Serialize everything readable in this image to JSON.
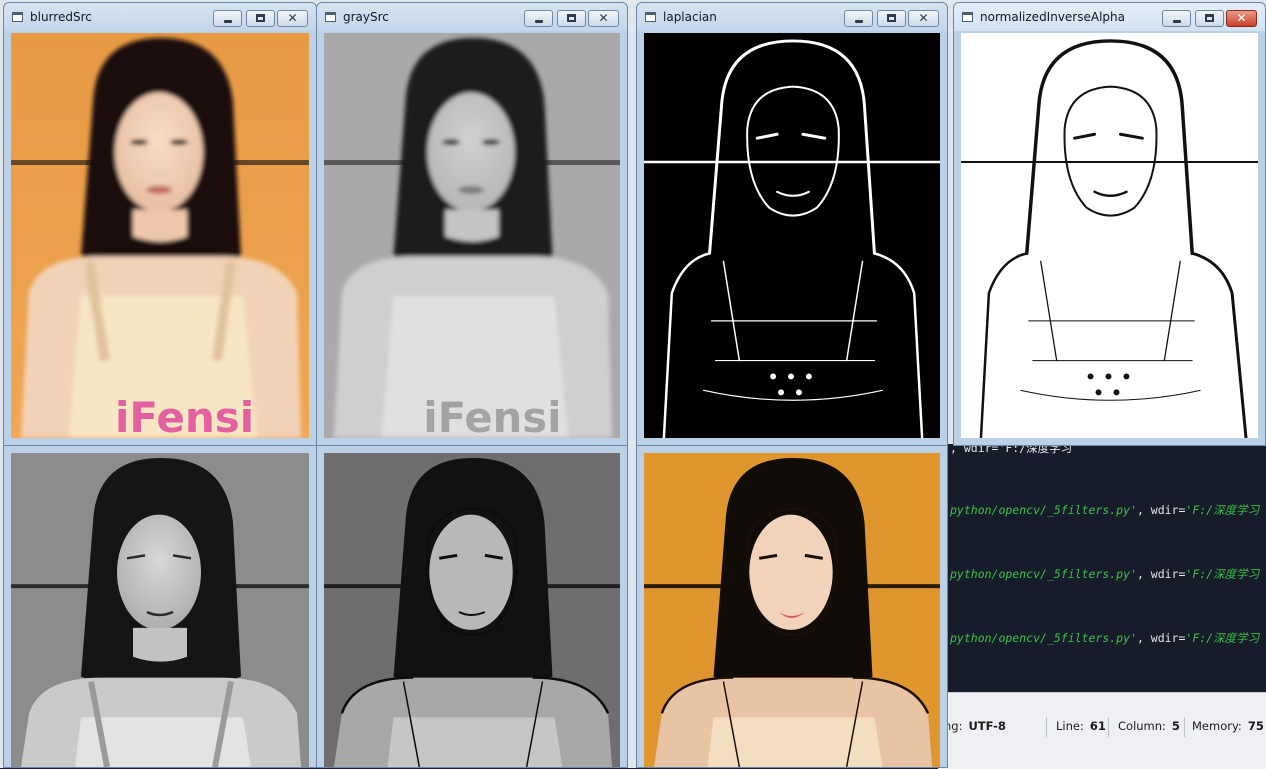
{
  "windows": [
    {
      "id": "blurredSrc",
      "title": "blurredSrc",
      "active": false,
      "controls": {
        "minimize": "minimize",
        "maximize": "maximize",
        "close": "close"
      }
    },
    {
      "id": "graySrc",
      "title": "graySrc",
      "active": false,
      "controls": {
        "minimize": "minimize",
        "maximize": "maximize",
        "close": "close"
      }
    },
    {
      "id": "laplacian",
      "title": "laplacian",
      "active": false,
      "controls": {
        "minimize": "minimize",
        "maximize": "maximize",
        "close": "close"
      }
    },
    {
      "id": "normalizedInverseAlpha",
      "title": "normalizedInverseAlpha",
      "active": true,
      "controls": {
        "minimize": "minimize",
        "maximize": "maximize",
        "close": "close"
      }
    }
  ],
  "image_overlay_text": "iFensi",
  "console": {
    "lines": [
      {
        "prefix": "",
        "path": "python/opencv/_5filters.py'",
        "sep": ", wdir=",
        "wdir": "'F:/深度学习"
      },
      {
        "prefix": "",
        "path": "python/opencv/_5filters.py'",
        "sep": ", wdir=",
        "wdir": "'F:/深度学习"
      },
      {
        "prefix": "",
        "path": "python/opencv/_5filters.py'",
        "sep": ", wdir=",
        "wdir": "'F:/深度学习"
      }
    ],
    "top_partial": ", wdir='F:/深度学习"
  },
  "statusbar": {
    "encoding_label": "ng:",
    "encoding_value": "UTF-8",
    "line_label": "Line:",
    "line_value": "61",
    "column_label": "Column:",
    "column_value": "5",
    "memory_label": "Memory:",
    "memory_value": "75"
  },
  "colors": {
    "window_frame": "#bcd1e6",
    "console_bg": "#161c2a",
    "console_green": "#3ec04a",
    "close_active": "#c7402c"
  }
}
